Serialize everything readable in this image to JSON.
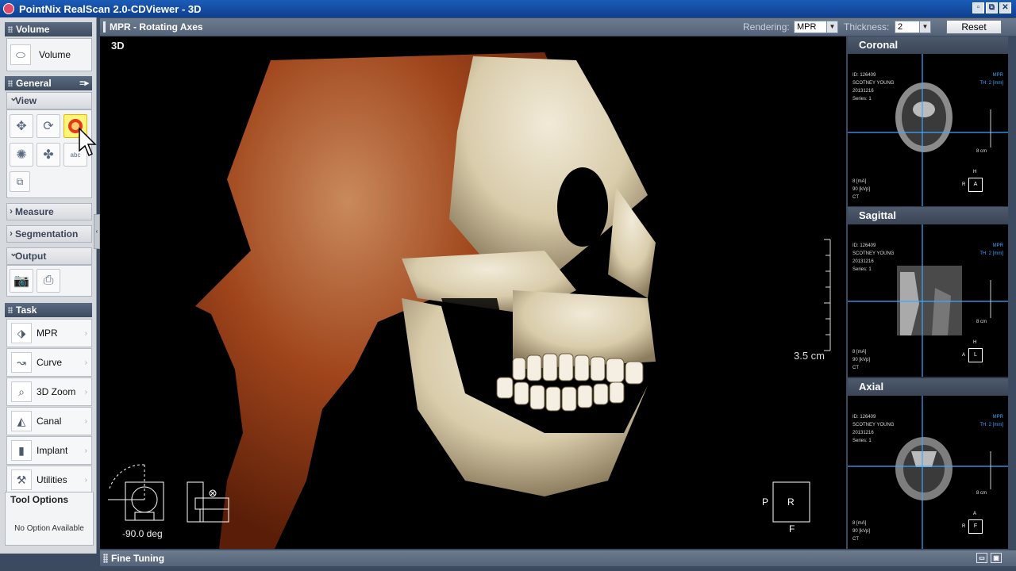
{
  "window": {
    "title": "PointNix RealScan 2.0-CDViewer - 3D",
    "buttons": [
      "restore",
      "restore-down",
      "close"
    ]
  },
  "left_panel": {
    "volume": {
      "header": "Volume",
      "button_label": "Volume"
    },
    "general": {
      "header": "General"
    },
    "view": {
      "header": "View",
      "tools": [
        "move-icon",
        "rotate-icon",
        "zoom-icon",
        "light-icon",
        "fan-icon",
        "text-annotation-icon",
        "copy-icon"
      ],
      "text_tool_label": "abc"
    },
    "measure": {
      "header": "Measure"
    },
    "segmentation": {
      "header": "Segmentation"
    },
    "output": {
      "header": "Output"
    },
    "task": {
      "header": "Task",
      "items": [
        {
          "label": "MPR",
          "icon": "mpr-icon"
        },
        {
          "label": "Curve",
          "icon": "curve-icon"
        },
        {
          "label": "3D Zoom",
          "icon": "zoom3d-icon"
        },
        {
          "label": "Canal",
          "icon": "canal-icon"
        },
        {
          "label": "Implant",
          "icon": "implant-icon"
        },
        {
          "label": "Utilities",
          "icon": "utilities-icon"
        }
      ]
    },
    "tool_options": {
      "header": "Tool Options",
      "text": "No Option Available"
    }
  },
  "top_strip": {
    "title": "MPR - Rotating Axes",
    "rendering_label": "Rendering:",
    "rendering_value": "MPR",
    "thickness_label": "Thickness:",
    "thickness_value": "2",
    "reset_label": "Reset"
  },
  "view3d": {
    "title": "3D",
    "scale_label": "3.5 cm",
    "angle_label": "-90.0 deg",
    "orientation": {
      "left": "P",
      "center": "R",
      "bottom": "F"
    }
  },
  "right_panels": [
    {
      "title": "Coronal",
      "id": "ID: 126409",
      "patient": "SCOTNEY YOUNG",
      "date": "20131216",
      "series": "Series: 1",
      "tag1": "MPR",
      "tag2": "TH: 2 [mm]",
      "scale": "8 cm",
      "ma": "8 [mA]",
      "kvp": "90 [kVp]",
      "modality": "CT",
      "orient_top": "H",
      "orient_left": "R",
      "orient_box": "A"
    },
    {
      "title": "Sagittal",
      "id": "ID: 126409",
      "patient": "SCOTNEY YOUNG",
      "date": "20131216",
      "series": "Series: 1",
      "tag1": "MPR",
      "tag2": "TH: 2 [mm]",
      "scale": "8 cm",
      "ma": "8 [mA]",
      "kvp": "90 [kVp]",
      "modality": "CT",
      "orient_top": "H",
      "orient_left": "A",
      "orient_box": "L"
    },
    {
      "title": "Axial",
      "id": "ID: 126409",
      "patient": "SCOTNEY YOUNG",
      "date": "20131216",
      "series": "Series: 1",
      "tag1": "MPR",
      "tag2": "TH: 2 [mm]",
      "scale": "8 cm",
      "ma": "8 [mA]",
      "kvp": "90 [kVp]",
      "modality": "CT",
      "orient_top": "A",
      "orient_left": "R",
      "orient_box": "F"
    }
  ],
  "bottom_strip": {
    "title": "Fine Tuning"
  },
  "colors": {
    "accent_blue": "#3fa6ff",
    "title_bar": "#1a5cb8",
    "bone": "#e6dcc4",
    "tissue": "#a0451c"
  }
}
